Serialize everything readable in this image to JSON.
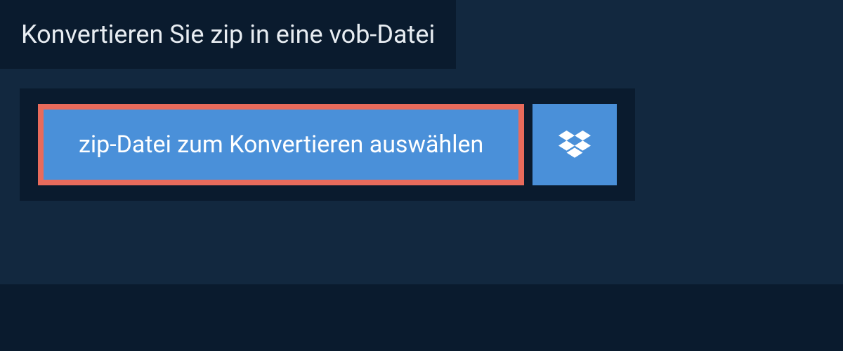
{
  "header": {
    "title": "Konvertieren Sie zip in eine vob-Datei"
  },
  "upload": {
    "select_label": "zip-Datei zum Konvertieren auswählen",
    "dropbox_icon": "dropbox"
  },
  "colors": {
    "background": "#12283f",
    "panel": "#0a1b2e",
    "button": "#4a90d9",
    "highlight_border": "#e86b5c",
    "text_light": "#e8edf2",
    "text_white": "#ffffff"
  }
}
